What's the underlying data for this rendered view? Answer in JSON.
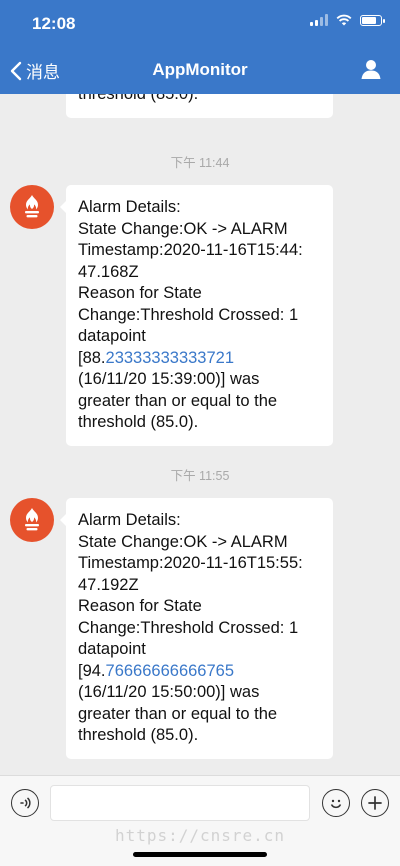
{
  "status_bar": {
    "time": "12:08"
  },
  "nav": {
    "back_label": "消息",
    "title": "AppMonitor"
  },
  "colors": {
    "nav_bg": "#3a78c9",
    "link": "#3a78c9",
    "avatar": "#e6522c"
  },
  "messages": [
    {
      "partial": true,
      "lines": [
        "threshold (85.0)."
      ]
    },
    {
      "timestamp": "下午 11:44",
      "lines": [
        "Alarm Details:",
        "State Change:OK -> ALARM",
        "Timestamp:2020-11-16T15:44:",
        "47.168Z",
        "Reason for State",
        "Change:Threshold Crossed: 1",
        "datapoint"
      ],
      "value_prefix": "[88.",
      "value_link": "23333333333721",
      "tail_lines": [
        "(16/11/20 15:39:00)] was",
        "greater than or equal to the",
        "threshold (85.0)."
      ]
    },
    {
      "timestamp": "下午 11:55",
      "lines": [
        "Alarm Details:",
        "State Change:OK -> ALARM",
        "Timestamp:2020-11-16T15:55:",
        "47.192Z",
        "Reason for State",
        "Change:Threshold Crossed: 1",
        "datapoint"
      ],
      "value_prefix": "[94.",
      "value_link": "76666666666765",
      "tail_lines": [
        "(16/11/20 15:50:00)] was",
        "greater than or equal to the",
        "threshold (85.0)."
      ]
    }
  ],
  "icons": [
    "chevron-left-icon",
    "user-icon",
    "voice-icon",
    "emoji-icon",
    "plus-icon",
    "wifi-icon",
    "signal-icon",
    "battery-icon"
  ],
  "watermark": "https://cnsre.cn"
}
